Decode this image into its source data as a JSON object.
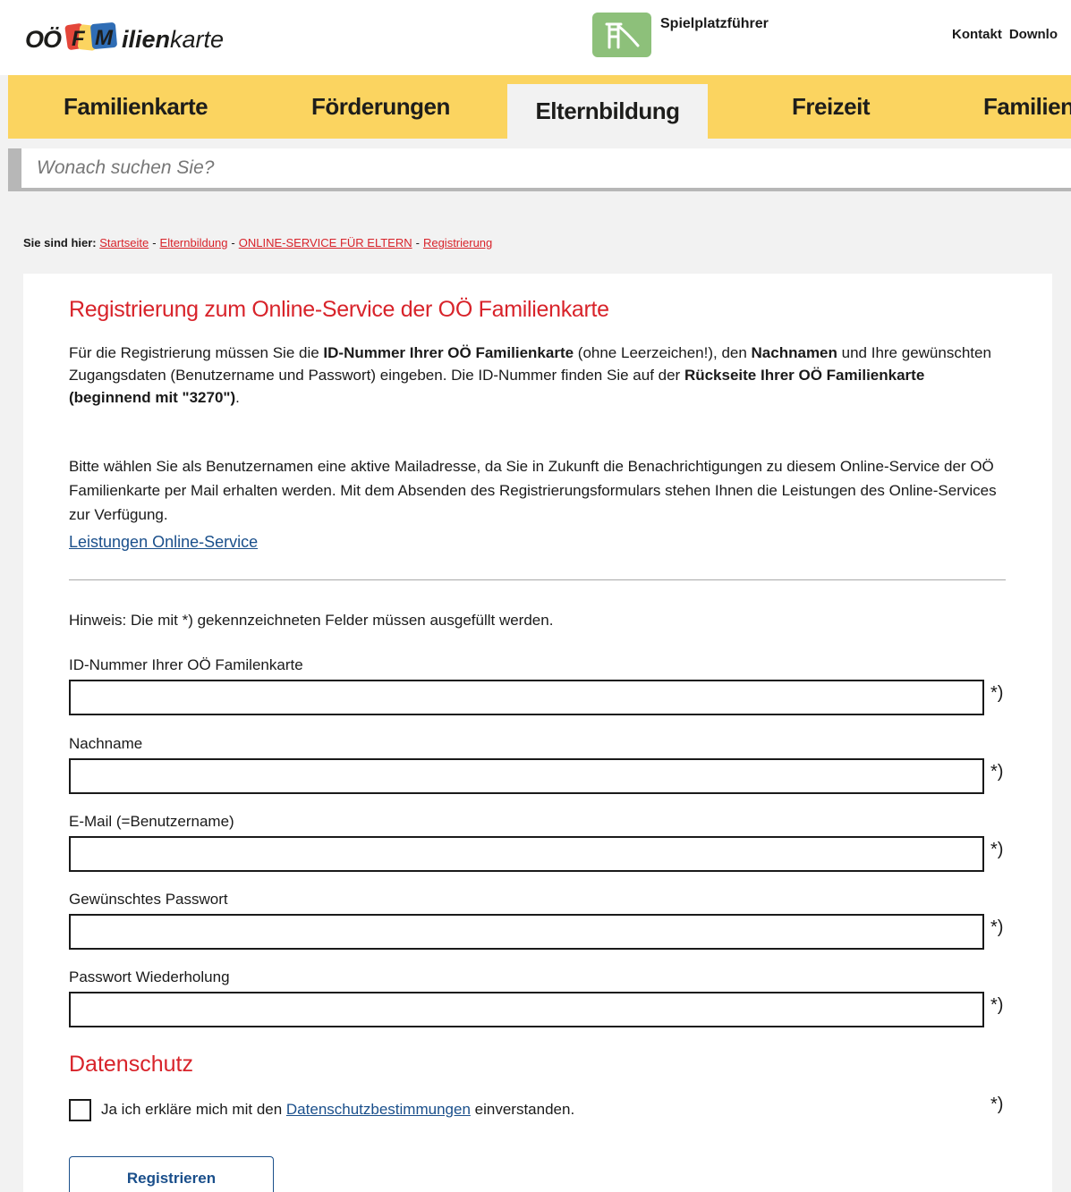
{
  "header": {
    "logo": {
      "oo": "OÖ",
      "mark": "FAM",
      "ilien": "ilien",
      "karte": "karte"
    },
    "playground_label": "Spielplatzführer",
    "links": [
      "Kontakt",
      "Downlo"
    ]
  },
  "nav": {
    "items": [
      "Familienkarte",
      "Förderungen",
      "Elternbildung",
      "Freizeit",
      "Familienp"
    ],
    "active": "Elternbildung"
  },
  "search": {
    "placeholder": "Wonach suchen Sie?"
  },
  "breadcrumb": {
    "prefix": "Sie sind hier:",
    "items": [
      "Startseite",
      "Elternbildung",
      "ONLINE-SERVICE FÜR ELTERN",
      "Registrierung"
    ]
  },
  "content": {
    "title": "Registrierung zum Online-Service der OÖ Familienkarte",
    "intro": {
      "t1": "Für die Registrierung müssen Sie die ",
      "b1": "ID-Nummer Ihrer OÖ Familienkarte",
      "t2": " (ohne Leerzeichen!), den ",
      "b2": "Nachnamen",
      "t3": " und Ihre gewünschten Zugangsdaten (Benutzername und Passwort) eingeben. Die ID-Nummer finden Sie auf der ",
      "b3": "Rückseite Ihrer OÖ Familienkarte (beginnend mit \"3270\")",
      "t4": "."
    },
    "para2": "Bitte wählen Sie als Benutzernamen eine aktive Mailadresse, da Sie in Zukunft die Benachrichtigungen zu diesem Online-Service der OÖ Familienkarte per Mail erhalten werden. Mit dem Absenden des Registrierungsformulars stehen Ihnen die Leistungen des Online-Services zur Verfügung.",
    "services_link": "Leistungen Online-Service",
    "hint": "Hinweis: Die mit *) gekennzeichneten Felder müssen ausgefüllt werden.",
    "required_mark": "*)",
    "fields": [
      {
        "label": "ID-Nummer Ihrer OÖ Familenkarte",
        "value": ""
      },
      {
        "label": "Nachname",
        "value": ""
      },
      {
        "label": "E-Mail (=Benutzername)",
        "value": ""
      },
      {
        "label": "Gewünschtes Passwort",
        "value": ""
      },
      {
        "label": "Passwort Wiederholung",
        "value": ""
      }
    ],
    "privacy": {
      "heading": "Datenschutz",
      "text_before": "Ja ich erkläre mich mit den ",
      "link": "Datenschutzbestimmungen",
      "text_after": " einverstanden.",
      "checked": false
    },
    "submit_label": "Registrieren"
  },
  "colors": {
    "nav_bg": "#fbd460",
    "accent_red": "#d8232a",
    "link_blue": "#1a4f8b",
    "page_bg": "#f2f2f2",
    "playground_green": "#8dc07a"
  }
}
